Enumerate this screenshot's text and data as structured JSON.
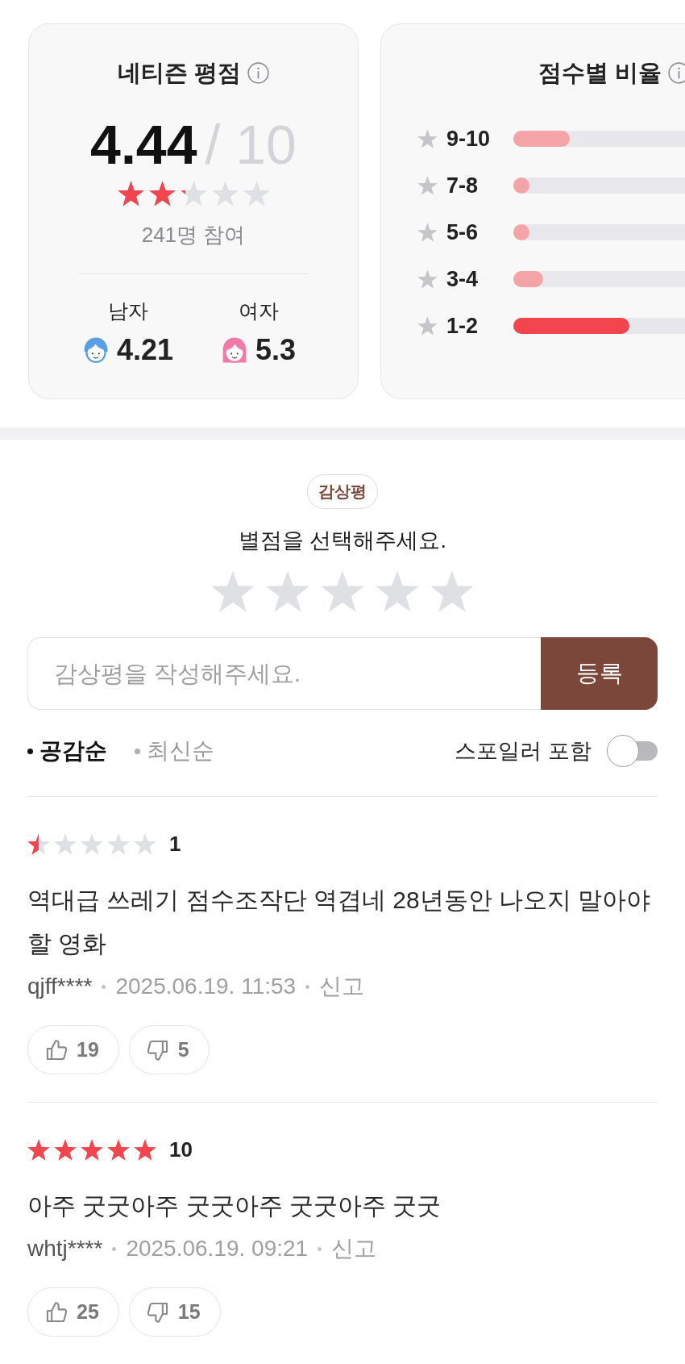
{
  "rating_card": {
    "title": "네티즌 평점",
    "score": "4.44",
    "max": "/ 10",
    "stars": 2.2,
    "participants": "241명 참여",
    "genders": [
      {
        "kind": "male",
        "label": "남자",
        "score": "4.21"
      },
      {
        "kind": "female",
        "label": "여자",
        "score": "5.3"
      }
    ]
  },
  "distribution_card": {
    "title": "점수별 비율",
    "rows": [
      {
        "label": "9-10",
        "level": 0.19,
        "highlighted": false
      },
      {
        "label": "7-8",
        "level": 0.05,
        "highlighted": false
      },
      {
        "label": "5-6",
        "level": 0.05,
        "highlighted": false
      },
      {
        "label": "3-4",
        "level": 0.1,
        "highlighted": false
      },
      {
        "label": "1-2",
        "level": 0.39,
        "highlighted": true
      }
    ]
  },
  "review_form": {
    "badge": "감상평",
    "prompt": "별점을 선택해주세요.",
    "stars": 0,
    "placeholder": "감상평을 작성해주세요.",
    "submit_button": "등록"
  },
  "sort_bar": {
    "options": [
      {
        "label": "공감순",
        "selected": true
      },
      {
        "label": "최신순",
        "selected": false
      }
    ],
    "spoiler_toggle": {
      "label": "스포일러 포함",
      "on": false
    }
  },
  "reviews": [
    {
      "stars": 0.5,
      "score": "1",
      "text": "역대급 쓰레기 점수조작단 역겹네 28년동안 나오지 말아야 할 영화",
      "author": "qjff****",
      "date": "2025.06.19. 11:53",
      "report": "신고",
      "likes": "19",
      "dislikes": "5"
    },
    {
      "stars": 5,
      "score": "10",
      "text": "아주 굿굿아주 굿굿아주 굿굿아주 굿굿",
      "author": "whtj****",
      "date": "2025.06.19. 09:21",
      "report": "신고",
      "likes": "25",
      "dislikes": "15"
    }
  ]
}
